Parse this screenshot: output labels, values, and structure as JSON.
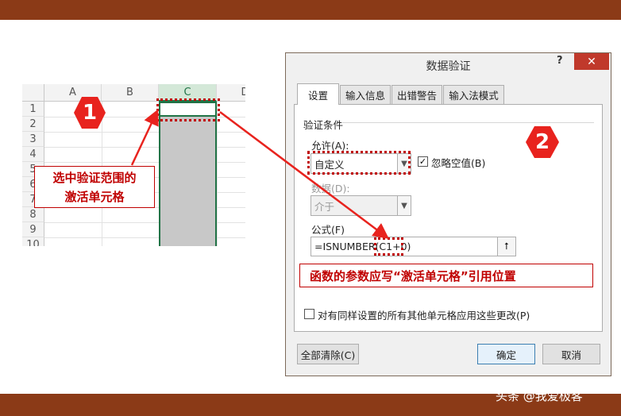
{
  "watermark": "头条 @我爱极客",
  "sheet": {
    "columns": [
      "A",
      "B",
      "C",
      "D"
    ],
    "rows": [
      "1",
      "2",
      "3",
      "4",
      "5",
      "6",
      "7",
      "8",
      "9",
      "10"
    ]
  },
  "badges": {
    "one": "1",
    "two": "2"
  },
  "callouts": {
    "select_range_line1": "选中验证范围的",
    "select_range_line2": "激活单元格",
    "formula_note": "函数的参数应写“激活单元格”引用位置"
  },
  "dialog": {
    "title": "数据验证",
    "help": "?",
    "close": "✕",
    "tabs": [
      "设置",
      "输入信息",
      "出错警告",
      "输入法模式"
    ],
    "section_title": "验证条件",
    "allow_label": "允许(A):",
    "allow_value": "自定义",
    "ignore_blank_label": "忽略空值(B)",
    "ignore_blank_checked": "✓",
    "data_label": "数据(D):",
    "data_value": "介于",
    "formula_label": "公式(F)",
    "formula_value": "=ISNUMBER(C1+0)",
    "ref_icon": "⭡",
    "apply_all_label": "对有同样设置的所有其他单元格应用这些更改(P)",
    "clear_all": "全部清除(C)",
    "ok": "确定",
    "cancel": "取消"
  },
  "colors": {
    "brand_band": "#8b3a17",
    "annotation_red": "#c00000",
    "excel_green": "#217346"
  }
}
